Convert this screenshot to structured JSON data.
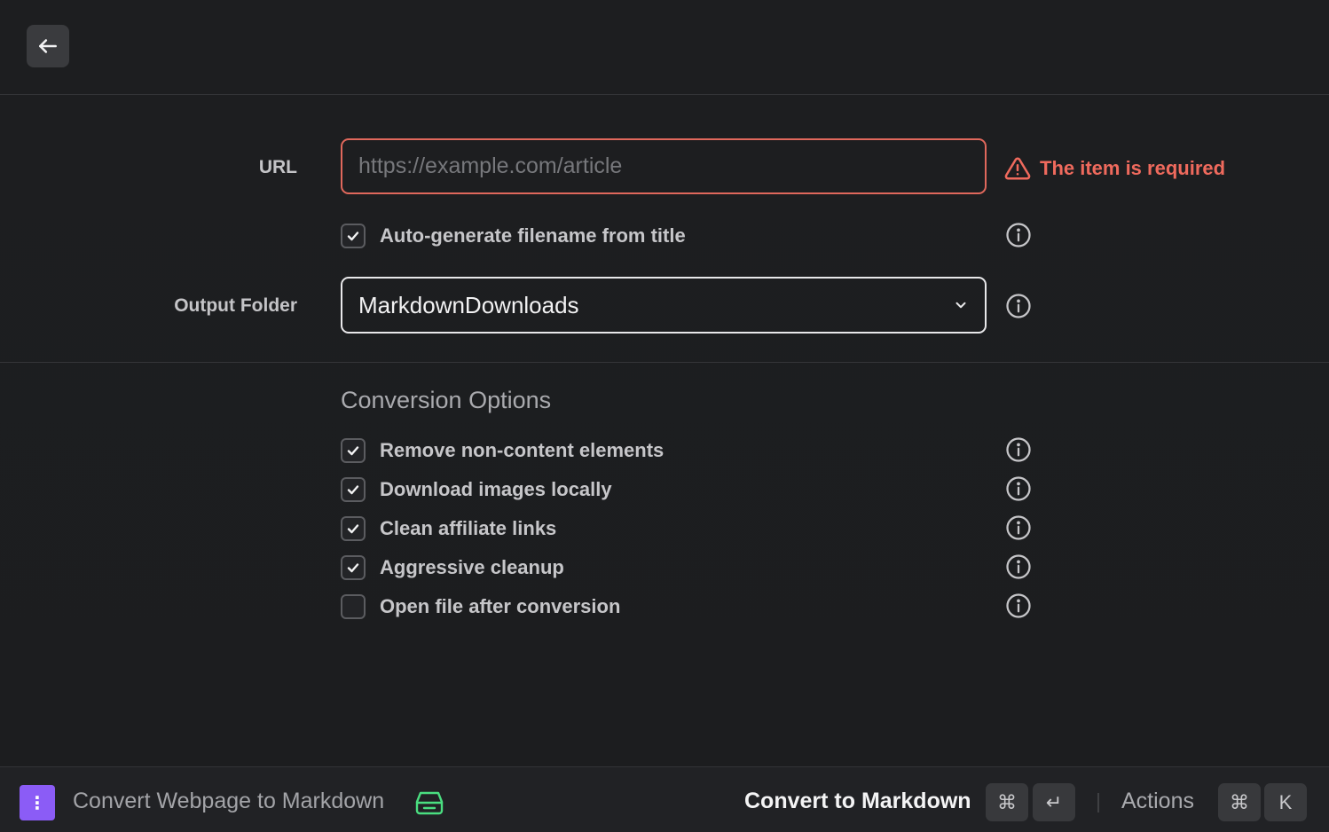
{
  "header": {
    "back_icon": "arrow-left-icon"
  },
  "form": {
    "url": {
      "label": "URL",
      "placeholder": "https://example.com/article",
      "value": "",
      "error": "The item is required",
      "error_icon": "warning-triangle-icon",
      "error_color": "#ef6a5d"
    },
    "auto_filename": {
      "label": "Auto-generate filename from title",
      "checked": true
    },
    "output_folder": {
      "label": "Output Folder",
      "value": "MarkdownDownloads",
      "icon": "chevron-down-icon"
    }
  },
  "conversion": {
    "title": "Conversion Options",
    "options": [
      {
        "label": "Remove non-content elements",
        "checked": true
      },
      {
        "label": "Download images locally",
        "checked": true
      },
      {
        "label": "Clean affiliate links",
        "checked": true
      },
      {
        "label": "Aggressive cleanup",
        "checked": true
      },
      {
        "label": "Open file after conversion",
        "checked": false
      }
    ]
  },
  "footer": {
    "app_icon_glyph": "⋮",
    "app_icon_color": "#8b5cf6",
    "title": "Convert Webpage to Markdown",
    "drive_icon": "drive-icon",
    "drive_icon_color": "#4ade80",
    "primary_action": "Convert to Markdown",
    "primary_shortcut": [
      "⌘",
      "↵"
    ],
    "actions_label": "Actions",
    "actions_shortcut": [
      "⌘",
      "K"
    ]
  }
}
